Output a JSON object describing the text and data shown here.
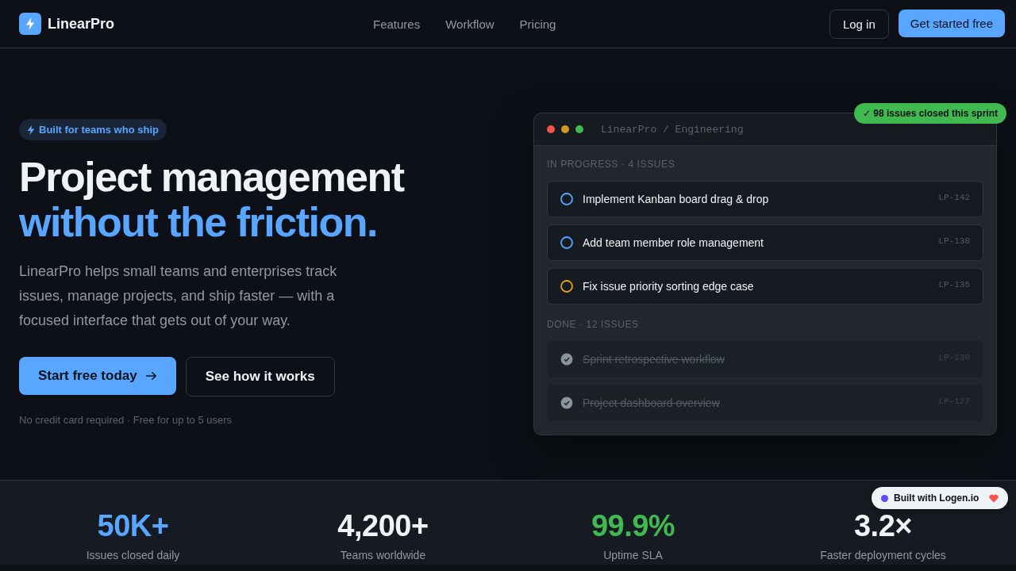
{
  "nav": {
    "brand": "LinearPro",
    "links": [
      "Features",
      "Workflow",
      "Pricing"
    ],
    "login": "Log in",
    "cta": "Get started free"
  },
  "hero": {
    "badge": "Built for teams who ship",
    "title_line1": "Project management",
    "title_line2": "without the friction.",
    "description": "LinearPro helps small teams and enterprises track issues, manage projects, and ship faster — with a focused interface that gets out of your way.",
    "primary_button": "Start free today",
    "secondary_button": "See how it works",
    "note": "No credit card required · Free for up to 5 users"
  },
  "preview": {
    "title": "LinearPro / Engineering",
    "sprint_badge": "✓ 98 issues closed this sprint",
    "groups": [
      {
        "heading": "IN PROGRESS · 4 ISSUES",
        "issues": [
          {
            "title": "Implement Kanban board drag & drop",
            "id": "LP-142",
            "done": false,
            "color": "#58a6ff"
          },
          {
            "title": "Add team member role management",
            "id": "LP-138",
            "done": false,
            "color": "#58a6ff"
          },
          {
            "title": "Fix issue priority sorting edge case",
            "id": "LP-135",
            "done": false,
            "color": "#e3a21a"
          }
        ]
      },
      {
        "heading": "DONE · 12 ISSUES",
        "issues": [
          {
            "title": "Sprint retrospective workflow",
            "id": "LP-130",
            "done": true,
            "color": "#8b949e"
          },
          {
            "title": "Project dashboard overview",
            "id": "LP-127",
            "done": true,
            "color": "#8b949e"
          }
        ]
      }
    ]
  },
  "stats": [
    {
      "value": "50K+",
      "label": "Issues closed daily",
      "color": "#58a6ff"
    },
    {
      "value": "4,200+",
      "label": "Teams worldwide",
      "color": "#f0f3f6"
    },
    {
      "value": "99.9%",
      "label": "Uptime SLA",
      "color": "#3fb950"
    },
    {
      "value": "3.2×",
      "label": "Faster deployment cycles",
      "color": "#f0f3f6"
    }
  ],
  "floating_badge": {
    "label": "Built with Logen.io"
  }
}
